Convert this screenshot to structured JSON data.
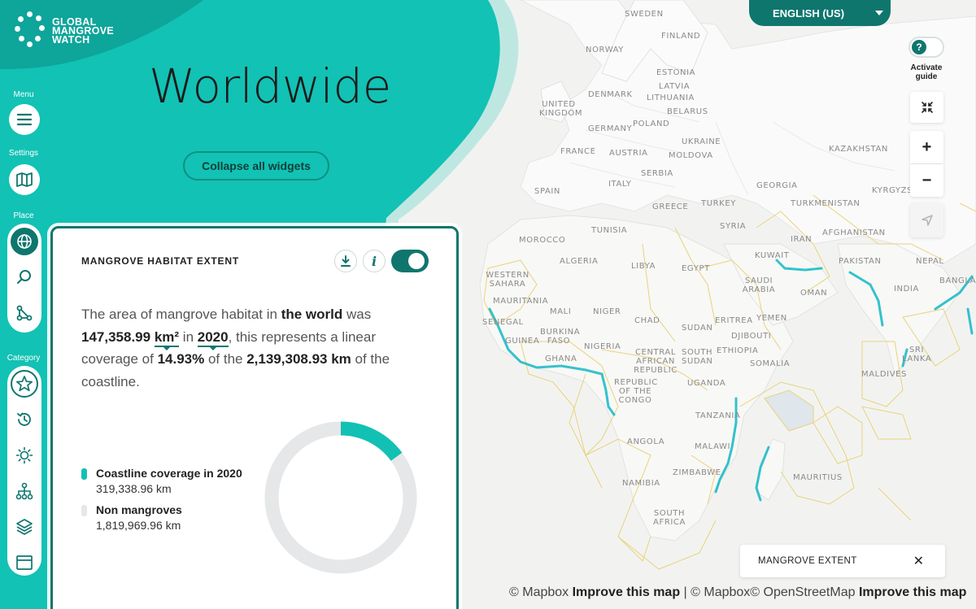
{
  "app": {
    "logo_text": [
      "GLOBAL",
      "MANGROVE",
      "WATCH"
    ]
  },
  "sidebar": {
    "menu_label": "Menu",
    "settings_label": "Settings",
    "place_label": "Place",
    "category_label": "Category",
    "place_items": [
      "globe-icon",
      "search-icon",
      "route-icon"
    ],
    "category_items": [
      "star-icon",
      "history-icon",
      "sun-icon",
      "hierarchy-icon",
      "layers-icon",
      "window-icon"
    ]
  },
  "header": {
    "title": "Worldwide",
    "collapse_label": "Collapse all widgets"
  },
  "widget": {
    "title": "MANGROVE HABITAT EXTENT",
    "summary": {
      "t1": "The area of mangrove habitat in ",
      "location": "the world",
      "t2": " was ",
      "area": "147,358.99",
      "unit": "km²",
      "t3": " in ",
      "year": "2020",
      "t4": ", this represents a linear coverage of ",
      "percent": "14.93%",
      "t5": " of the ",
      "coastline": "2,139,308.93 km",
      "t6": " of the coastline."
    },
    "legend": [
      {
        "name": "Coastline coverage in 2020",
        "value": "319,338.96",
        "unit": "km",
        "color": "#13c0b4"
      },
      {
        "name": "Non mangroves",
        "value": "1,819,969.96",
        "unit": "km",
        "color": "#e6e7e8"
      }
    ]
  },
  "chart_data": {
    "type": "pie",
    "style": "donut",
    "categories": [
      "Coastline coverage in 2020",
      "Non mangroves"
    ],
    "values": [
      319338.96,
      1819969.96
    ],
    "colors": [
      "#13c0b4",
      "#e6e7e8"
    ]
  },
  "controls": {
    "language": "ENGLISH (US)",
    "guide_label": "Activate guide",
    "zoom_in": "+",
    "zoom_out": "−"
  },
  "layer_panel": {
    "label": "MANGROVE EXTENT"
  },
  "attribution": {
    "mapbox": "© Mapbox",
    "improve": "Improve this map",
    "sep": " | ",
    "mapbox2": "© Mapbox",
    "osm": "© OpenStreetMap"
  },
  "map_labels": [
    "SWEDEN",
    "FINLAND",
    "NORWAY",
    "ESTONIA",
    "LATVIA",
    "DENMARK",
    "LITHUANIA",
    "UNITED KINGDOM",
    "BELARUS",
    "POLAND",
    "GERMANY",
    "UKRAINE",
    "FRANCE",
    "AUSTRIA",
    "MOLDOVA",
    "KAZAKHSTAN",
    "SERBIA",
    "SPAIN",
    "ITALY",
    "GEORGIA",
    "KYRGYZSTAN",
    "GREECE",
    "TURKEY",
    "TURKMENISTAN",
    "SYRIA",
    "TUNISIA",
    "MOROCCO",
    "IRAN",
    "AFGHANISTAN",
    "ALGERIA",
    "LIBYA",
    "EGYPT",
    "KUWAIT",
    "PAKISTAN",
    "NEPAL",
    "WESTERN SAHARA",
    "SAUDI ARABIA",
    "OMAN",
    "INDIA",
    "BANGLADES",
    "MAURITANIA",
    "MALI",
    "NIGER",
    "ERITREA",
    "YEMEN",
    "SENEGAL",
    "BURKINA FASO",
    "CHAD",
    "SUDAN",
    "DJIBOUTI",
    "GUINEA",
    "GHANA",
    "NIGERIA",
    "CENTRAL AFRICAN REPUBLIC",
    "SOUTH SUDAN",
    "ETHIOPIA",
    "SRI LANKA",
    "SOMALIA",
    "MALDIVES",
    "REPUBLIC OF THE CONGO",
    "UGANDA",
    "TANZANIA",
    "ANGOLA",
    "MALAWI",
    "ZIMBABWE",
    "MAURITIUS",
    "NAMIBIA",
    "SOUTH AFRICA"
  ]
}
